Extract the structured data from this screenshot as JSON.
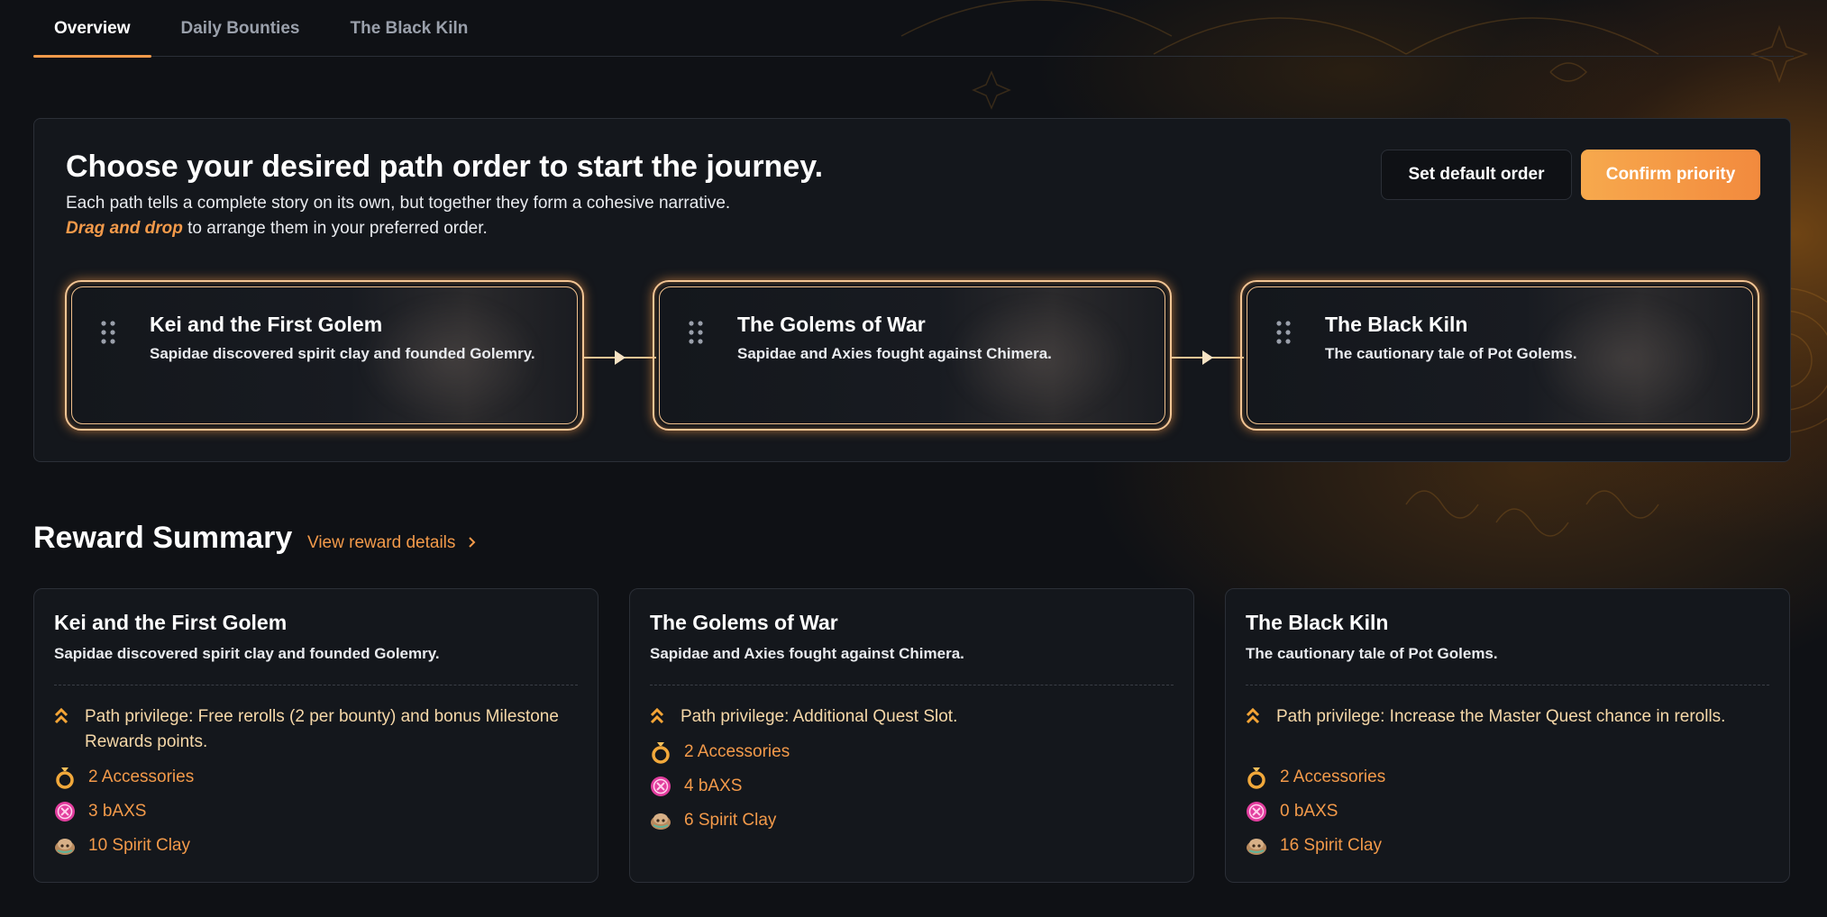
{
  "tabs": [
    {
      "label": "Overview",
      "active": true
    },
    {
      "label": "Daily Bounties",
      "active": false
    },
    {
      "label": "The Black Kiln",
      "active": false
    }
  ],
  "path_panel": {
    "title": "Choose your desired path order to start the journey.",
    "description": "Each path tells a complete story on its own, but together they form a cohesive narrative.",
    "drag_hint_highlight": "Drag and drop",
    "drag_hint_rest": " to arrange them in your preferred order.",
    "default_button": "Set default order",
    "confirm_button": "Confirm priority",
    "paths": [
      {
        "title": "Kei and the First Golem",
        "description": "Sapidae discovered spirit clay and founded Golemry."
      },
      {
        "title": "The Golems of War",
        "description": "Sapidae and Axies fought against Chimera."
      },
      {
        "title": "The Black Kiln",
        "description": "The cautionary tale of Pot Golems."
      }
    ]
  },
  "reward_summary": {
    "heading": "Reward Summary",
    "details_link": "View reward details",
    "cards": [
      {
        "title": "Kei and the First Golem",
        "description": "Sapidae discovered spirit clay and founded Golemry.",
        "privilege": "Path privilege: Free rerolls (2 per bounty) and bonus Milestone Rewards points.",
        "accessories": "2 Accessories",
        "baxs": "3 bAXS",
        "spirit_clay": "10 Spirit Clay"
      },
      {
        "title": "The Golems of War",
        "description": "Sapidae and Axies fought against Chimera.",
        "privilege": "Path privilege: Additional Quest Slot.",
        "accessories": "2 Accessories",
        "baxs": "4 bAXS",
        "spirit_clay": "6 Spirit Clay"
      },
      {
        "title": "The Black Kiln",
        "description": "The cautionary tale of Pot Golems.",
        "privilege": "Path privilege: Increase the Master Quest chance in rerolls.",
        "accessories": "2 Accessories",
        "baxs": "0 bAXS",
        "spirit_clay": "16 Spirit Clay"
      }
    ]
  },
  "icons": {
    "drag": "drag-handle-icon",
    "arrow": "arrow-right-icon",
    "privilege": "chevron-up-double-icon",
    "accessories": "ring-icon",
    "baxs": "baxs-token-icon",
    "spirit_clay": "spirit-clay-icon"
  },
  "colors": {
    "background": "#0f1115",
    "panel": "#14171c",
    "accent": "#f39a4a",
    "privilege_text": "#f6d8a8",
    "card_border_glow": "#f3c594"
  }
}
